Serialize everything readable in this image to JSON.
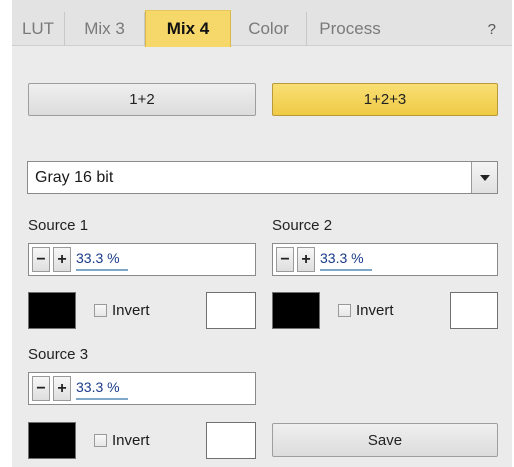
{
  "tabs": [
    {
      "label": "LUT",
      "active": false
    },
    {
      "label": "Mix 3",
      "active": false
    },
    {
      "label": "Mix 4",
      "active": true
    },
    {
      "label": "Color",
      "active": false
    },
    {
      "label": "Process",
      "active": false
    }
  ],
  "help_label": "?",
  "mode_buttons": {
    "mode_a": "1+2",
    "mode_b": "1+2+3",
    "selected": "1+2+3"
  },
  "format_select": {
    "value": "Gray 16 bit"
  },
  "sources": [
    {
      "label": "Source 1",
      "value": "33.3 %",
      "color": "#000000",
      "invert_label": "Invert",
      "invert_checked": false,
      "second_color": "#ffffff"
    },
    {
      "label": "Source 2",
      "value": "33.3 %",
      "color": "#000000",
      "invert_label": "Invert",
      "invert_checked": false,
      "second_color": "#ffffff"
    },
    {
      "label": "Source 3",
      "value": "33.3 %",
      "color": "#000000",
      "invert_label": "Invert",
      "invert_checked": false,
      "second_color": "#ffffff"
    }
  ],
  "stepper_minus": "−",
  "stepper_plus": "+",
  "save_label": "Save",
  "colors": {
    "accent": "#f3d35a",
    "panel": "#ebebeb"
  }
}
